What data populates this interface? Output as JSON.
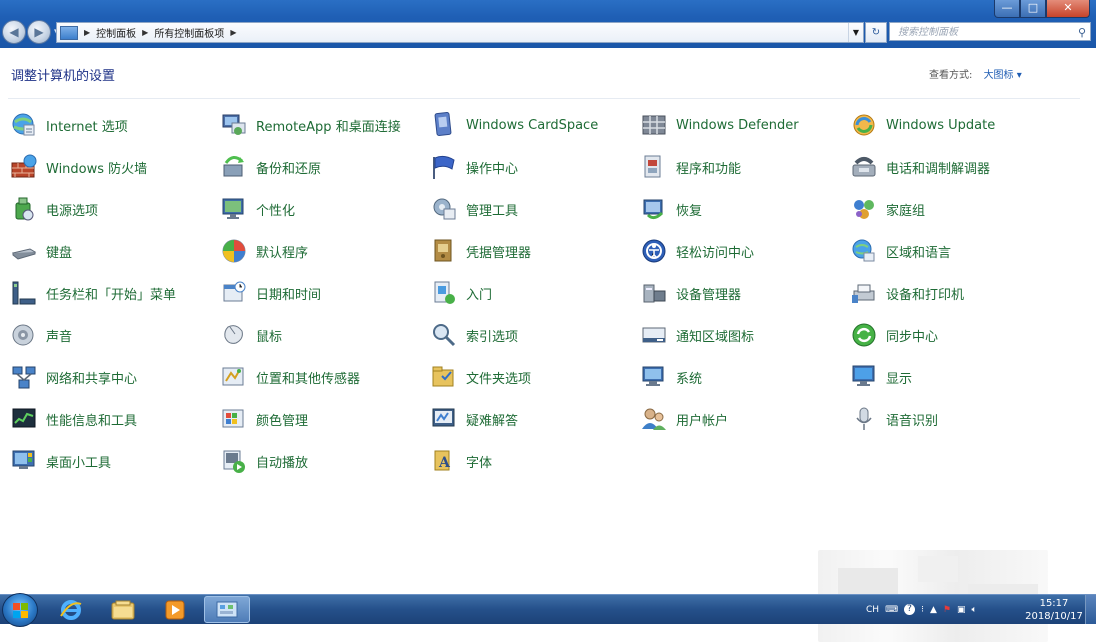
{
  "window": {
    "controls": {
      "minimize": "—",
      "maximize": "□",
      "close": "✕"
    }
  },
  "address": {
    "crumbs": [
      "控制面板",
      "所有控制面板项"
    ],
    "search_placeholder": "搜索控制面板"
  },
  "header": {
    "title": "调整计算机的设置",
    "view_by_label": "查看方式:",
    "view_by_value": "大图标 ▾"
  },
  "colors": {
    "link_green": "#1e6b35",
    "title_blue": "#1e3287",
    "taskbar": "#25508a"
  },
  "items": [
    {
      "label": "Internet 选项",
      "icon": "internet-options-icon"
    },
    {
      "label": "RemoteApp 和桌面连接",
      "icon": "remoteapp-icon"
    },
    {
      "label": "Windows CardSpace",
      "icon": "cardspace-icon"
    },
    {
      "label": "Windows Defender",
      "icon": "defender-icon"
    },
    {
      "label": "Windows Update",
      "icon": "windows-update-icon"
    },
    {
      "label": "Windows 防火墙",
      "icon": "firewall-icon"
    },
    {
      "label": "备份和还原",
      "icon": "backup-icon"
    },
    {
      "label": "操作中心",
      "icon": "action-center-flag-icon"
    },
    {
      "label": "程序和功能",
      "icon": "programs-icon"
    },
    {
      "label": "电话和调制解调器",
      "icon": "phone-modem-icon"
    },
    {
      "label": "电源选项",
      "icon": "power-options-icon"
    },
    {
      "label": "个性化",
      "icon": "personalization-icon"
    },
    {
      "label": "管理工具",
      "icon": "admin-tools-icon"
    },
    {
      "label": "恢复",
      "icon": "recovery-icon"
    },
    {
      "label": "家庭组",
      "icon": "homegroup-icon"
    },
    {
      "label": "键盘",
      "icon": "keyboard-icon"
    },
    {
      "label": "默认程序",
      "icon": "default-programs-icon"
    },
    {
      "label": "凭据管理器",
      "icon": "credential-manager-icon"
    },
    {
      "label": "轻松访问中心",
      "icon": "ease-of-access-icon"
    },
    {
      "label": "区域和语言",
      "icon": "region-language-icon"
    },
    {
      "label": "任务栏和「开始」菜单",
      "icon": "taskbar-start-icon"
    },
    {
      "label": "日期和时间",
      "icon": "date-time-icon"
    },
    {
      "label": "入门",
      "icon": "getting-started-icon"
    },
    {
      "label": "设备管理器",
      "icon": "device-manager-icon"
    },
    {
      "label": "设备和打印机",
      "icon": "devices-printers-icon"
    },
    {
      "label": "声音",
      "icon": "sound-icon"
    },
    {
      "label": "鼠标",
      "icon": "mouse-icon"
    },
    {
      "label": "索引选项",
      "icon": "indexing-icon"
    },
    {
      "label": "通知区域图标",
      "icon": "notification-area-icon"
    },
    {
      "label": "同步中心",
      "icon": "sync-center-icon"
    },
    {
      "label": "网络和共享中心",
      "icon": "network-sharing-icon"
    },
    {
      "label": "位置和其他传感器",
      "icon": "location-sensors-icon"
    },
    {
      "label": "文件夹选项",
      "icon": "folder-options-icon"
    },
    {
      "label": "系统",
      "icon": "system-icon"
    },
    {
      "label": "显示",
      "icon": "display-icon"
    },
    {
      "label": "性能信息和工具",
      "icon": "performance-icon"
    },
    {
      "label": "颜色管理",
      "icon": "color-management-icon"
    },
    {
      "label": "疑难解答",
      "icon": "troubleshooting-icon"
    },
    {
      "label": "用户帐户",
      "icon": "user-accounts-icon"
    },
    {
      "label": "语音识别",
      "icon": "speech-recognition-icon"
    },
    {
      "label": "桌面小工具",
      "icon": "desktop-gadgets-icon"
    },
    {
      "label": "自动播放",
      "icon": "autoplay-icon"
    },
    {
      "label": "字体",
      "icon": "fonts-icon"
    }
  ],
  "taskbar": {
    "apps": [
      "internet-explorer-icon",
      "explorer-folder-icon",
      "media-player-icon",
      "control-panel-icon"
    ],
    "tray": {
      "lang": "CH",
      "time": "15:17",
      "date": "2018/10/17"
    }
  }
}
